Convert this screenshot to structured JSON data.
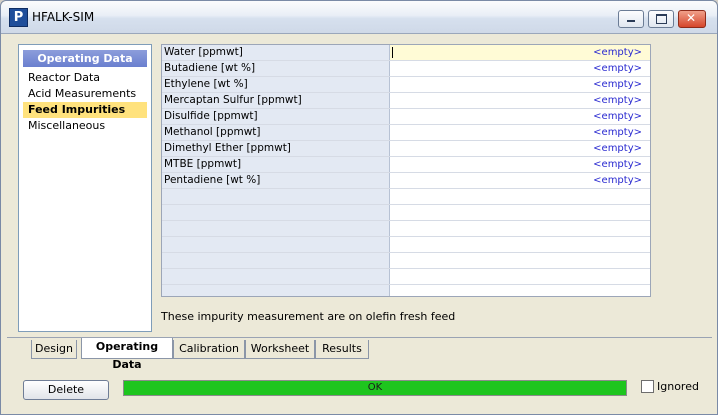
{
  "window": {
    "title": "HFALK-SIM",
    "app_icon": "P"
  },
  "nav": {
    "header": "Operating Data",
    "items": [
      {
        "label": "Reactor Data",
        "active": false
      },
      {
        "label": "Acid Measurements",
        "active": false
      },
      {
        "label": "Feed Impurities",
        "active": true
      },
      {
        "label": "Miscellaneous",
        "active": false
      }
    ]
  },
  "grid": {
    "rows": [
      {
        "label": "Water [ppmwt]",
        "value": "<empty>"
      },
      {
        "label": "Butadiene [wt %]",
        "value": "<empty>"
      },
      {
        "label": "Ethylene [wt %]",
        "value": "<empty>"
      },
      {
        "label": "Mercaptan Sulfur [ppmwt]",
        "value": "<empty>"
      },
      {
        "label": "Disulfide [ppmwt]",
        "value": "<empty>"
      },
      {
        "label": "Methanol [ppmwt]",
        "value": "<empty>"
      },
      {
        "label": "Dimethyl Ether [ppmwt]",
        "value": "<empty>"
      },
      {
        "label": "MTBE [ppmwt]",
        "value": "<empty>"
      },
      {
        "label": "Pentadiene [wt %]",
        "value": "<empty>"
      }
    ]
  },
  "note": "These impurity measurement are on olefin fresh feed",
  "tabs": [
    {
      "label": "Design",
      "active": false
    },
    {
      "label": "Operating Data",
      "active": true
    },
    {
      "label": "Calibration",
      "active": false
    },
    {
      "label": "Worksheet",
      "active": false
    },
    {
      "label": "Results",
      "active": false
    }
  ],
  "footer": {
    "delete_label": "Delete",
    "status_text": "OK",
    "status_color": "#1ec51e",
    "ignored_label": "Ignored",
    "ignored_checked": false
  }
}
